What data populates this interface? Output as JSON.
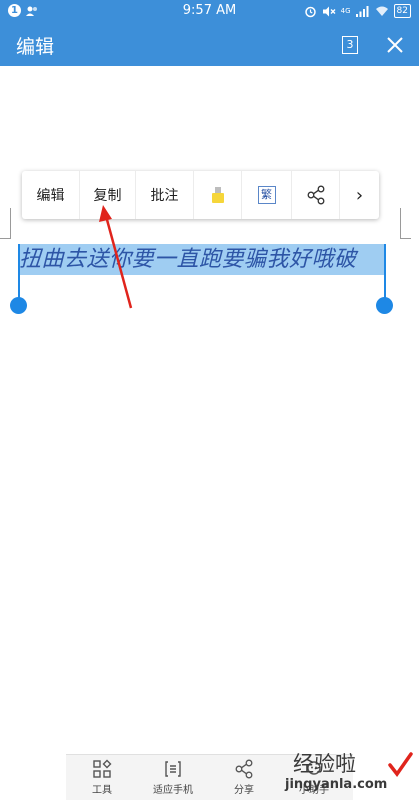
{
  "status_bar": {
    "notification_count": "1",
    "time": "9:57 AM",
    "network_type": "4G",
    "battery": "82"
  },
  "title_bar": {
    "title": "编辑",
    "page_count": "3"
  },
  "context_menu": {
    "items": [
      {
        "label": "编辑"
      },
      {
        "label": "复制"
      },
      {
        "label": "批注"
      },
      {
        "icon": "highlighter-icon"
      },
      {
        "icon": "traditional-chinese-icon",
        "glyph": "繁"
      },
      {
        "icon": "share-icon"
      },
      {
        "icon": "more-arrow-icon",
        "glyph": "›"
      }
    ]
  },
  "document": {
    "selected_text": "扭曲去送你要一直跑要骗我好哦破"
  },
  "bottom_toolbar": {
    "items": [
      {
        "label": "工具",
        "icon": "tools-grid-icon"
      },
      {
        "label": "适应手机",
        "icon": "fit-phone-icon"
      },
      {
        "label": "分享",
        "icon": "share-icon"
      },
      {
        "label": "小助手",
        "icon": "assistant-icon"
      }
    ]
  },
  "watermark": {
    "title": "经验啦",
    "url": "jingyanla.com"
  },
  "colors": {
    "header_blue": "#3d8fd9",
    "selection": "#9fcdf2",
    "handle_blue": "#1e88e5",
    "annotation_arrow": "#e0241c",
    "highlighter_yellow": "#f6d63a"
  }
}
